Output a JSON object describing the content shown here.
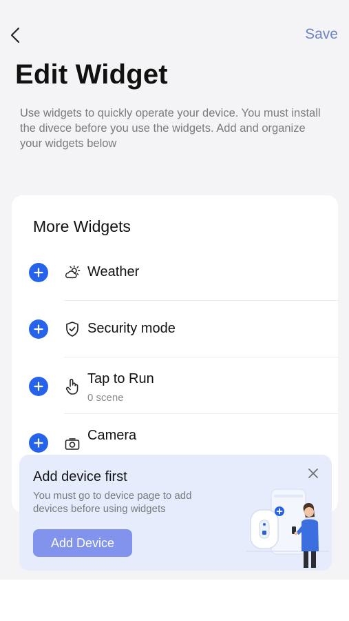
{
  "header": {
    "back_icon": "chevron-left-icon",
    "save_label": "Save",
    "save_color": "#6b83c8"
  },
  "page": {
    "title": "Edit Widget",
    "description": "Use widgets to quickly operate your device. You must install the divece before you use the widgets. Add and organize your widgets below"
  },
  "more_widgets": {
    "title": "More Widgets",
    "add_icon": "plus-circle-icon",
    "add_color": "#2563eb",
    "items": [
      {
        "name": "Weather",
        "subtitle": "",
        "icon": "weather-icon"
      },
      {
        "name": "Security mode",
        "subtitle": "",
        "icon": "shield-check-icon"
      },
      {
        "name": "Tap to Run",
        "subtitle": "0 scene",
        "icon": "tap-hand-icon"
      },
      {
        "name": "Camera",
        "subtitle": "",
        "icon": "camera-icon"
      }
    ]
  },
  "banner": {
    "title": "Add device first",
    "description": "You must go to device page to add devices before using widgets",
    "button_label": "Add Device",
    "button_color": "#8193ec",
    "background": "#e6ecfb",
    "close_icon": "close-icon",
    "illustration": "person-with-phone-illustration"
  }
}
